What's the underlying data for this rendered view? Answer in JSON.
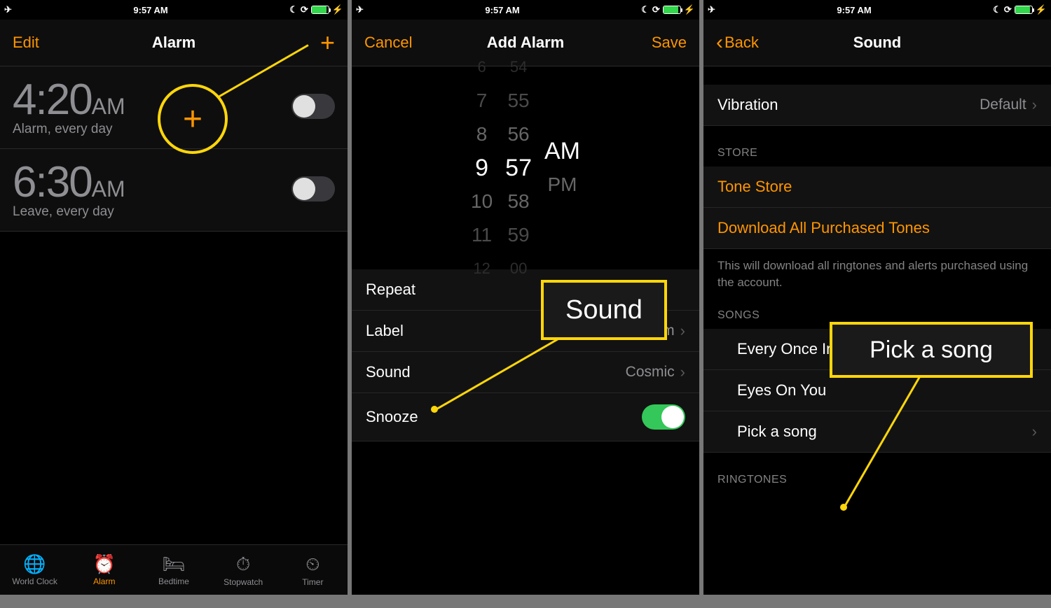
{
  "status": {
    "time": "9:57 AM",
    "airplane": true,
    "dnd": true,
    "rotation_lock": true,
    "charging": true
  },
  "screen1": {
    "nav": {
      "left": "Edit",
      "title": "Alarm",
      "right_icon": "+"
    },
    "alarms": [
      {
        "time": "4:20",
        "ampm": "AM",
        "label": "Alarm, every day",
        "on": false
      },
      {
        "time": "6:30",
        "ampm": "AM",
        "label": "Leave, every day",
        "on": false
      }
    ],
    "tabs": [
      {
        "label": "World Clock",
        "active": false
      },
      {
        "label": "Alarm",
        "active": true
      },
      {
        "label": "Bedtime",
        "active": false
      },
      {
        "label": "Stopwatch",
        "active": false
      },
      {
        "label": "Timer",
        "active": false
      }
    ],
    "callout_plus": "+"
  },
  "screen2": {
    "nav": {
      "left": "Cancel",
      "title": "Add Alarm",
      "right": "Save"
    },
    "picker": {
      "hours": [
        "6",
        "7",
        "8",
        "9",
        "10",
        "11",
        "12"
      ],
      "minutes": [
        "54",
        "55",
        "56",
        "57",
        "58",
        "59",
        "00"
      ],
      "ampm": [
        "AM",
        "PM"
      ],
      "selected_hour": "9",
      "selected_minute": "57",
      "selected_ampm": "AM"
    },
    "rows": {
      "repeat_label": "Repeat",
      "label_label": "Label",
      "label_value": "Alarm",
      "sound_label": "Sound",
      "sound_value": "Cosmic",
      "snooze_label": "Snooze",
      "snooze_on": true
    },
    "callout_box": "Sound"
  },
  "screen3": {
    "nav": {
      "back": "Back",
      "title": "Sound"
    },
    "vibration": {
      "label": "Vibration",
      "value": "Default"
    },
    "store_header": "STORE",
    "store_links": [
      "Tone Store",
      "Download All Purchased Tones"
    ],
    "store_note": "This will download all ringtones and alerts purchased using the account.",
    "songs_header": "SONGS",
    "songs": [
      "Every Once In A While",
      "Eyes On You"
    ],
    "pick_label": "Pick a song",
    "ringtones_header": "RINGTONES",
    "callout_box": "Pick a song"
  }
}
